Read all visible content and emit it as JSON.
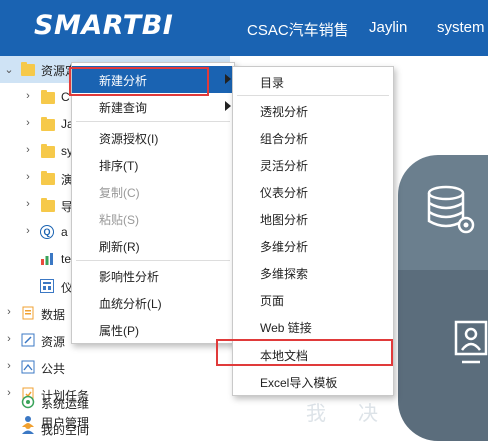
{
  "header": {
    "logo": "SMARTBI",
    "company": "CSAC汽车销售",
    "user": "Jaylin",
    "system": "system"
  },
  "colors": {
    "brand": "#1a63b2",
    "highlight": "#1a63b2",
    "callout": "#e03a3a",
    "selected_row": "#cfe3f5"
  },
  "tree": {
    "rows": [
      {
        "label": "资源定制",
        "icon": "folder-icon"
      },
      {
        "label": "C",
        "icon": "folder-icon"
      },
      {
        "label": "Ja",
        "icon": "folder-icon"
      },
      {
        "label": "sy",
        "icon": "folder-icon"
      },
      {
        "label": "演",
        "icon": "folder-icon"
      },
      {
        "label": "导",
        "icon": "folder-icon"
      },
      {
        "label": "a",
        "icon": "query-icon"
      },
      {
        "label": "te",
        "icon": "chart-icon"
      },
      {
        "label": "仪",
        "icon": "dashboard-icon"
      },
      {
        "label": "数据",
        "icon": "data-icon"
      },
      {
        "label": "资源",
        "icon": "resource-icon"
      },
      {
        "label": "公共",
        "icon": "public-icon"
      },
      {
        "label": "计划任务",
        "icon": "schedule-icon"
      },
      {
        "label": "用户管理",
        "icon": "user-mgmt-icon"
      },
      {
        "label": "系统运维",
        "icon": "maintenance-icon"
      },
      {
        "label": "我的空间",
        "icon": "my-space-icon"
      }
    ]
  },
  "context_menu": {
    "items": [
      {
        "label": "新建分析"
      },
      {
        "label": "新建查询"
      },
      {
        "label": "资源授权(I)"
      },
      {
        "label": "排序(T)"
      },
      {
        "label": "复制(C)"
      },
      {
        "label": "粘贴(S)"
      },
      {
        "label": "刷新(R)"
      },
      {
        "label": "影响性分析"
      },
      {
        "label": "血统分析(L)"
      },
      {
        "label": "属性(P)"
      }
    ]
  },
  "submenu": {
    "items": [
      {
        "label": "目录"
      },
      {
        "label": "透视分析"
      },
      {
        "label": "组合分析"
      },
      {
        "label": "灵活分析"
      },
      {
        "label": "仪表分析"
      },
      {
        "label": "地图分析"
      },
      {
        "label": "多维分析"
      },
      {
        "label": "多维探索"
      },
      {
        "label": "页面"
      },
      {
        "label": "Web 链接"
      },
      {
        "label": "本地文档"
      },
      {
        "label": "Excel导入模板"
      }
    ]
  },
  "background": {
    "ghost_text_1": "我",
    "ghost_text_2": "决"
  }
}
